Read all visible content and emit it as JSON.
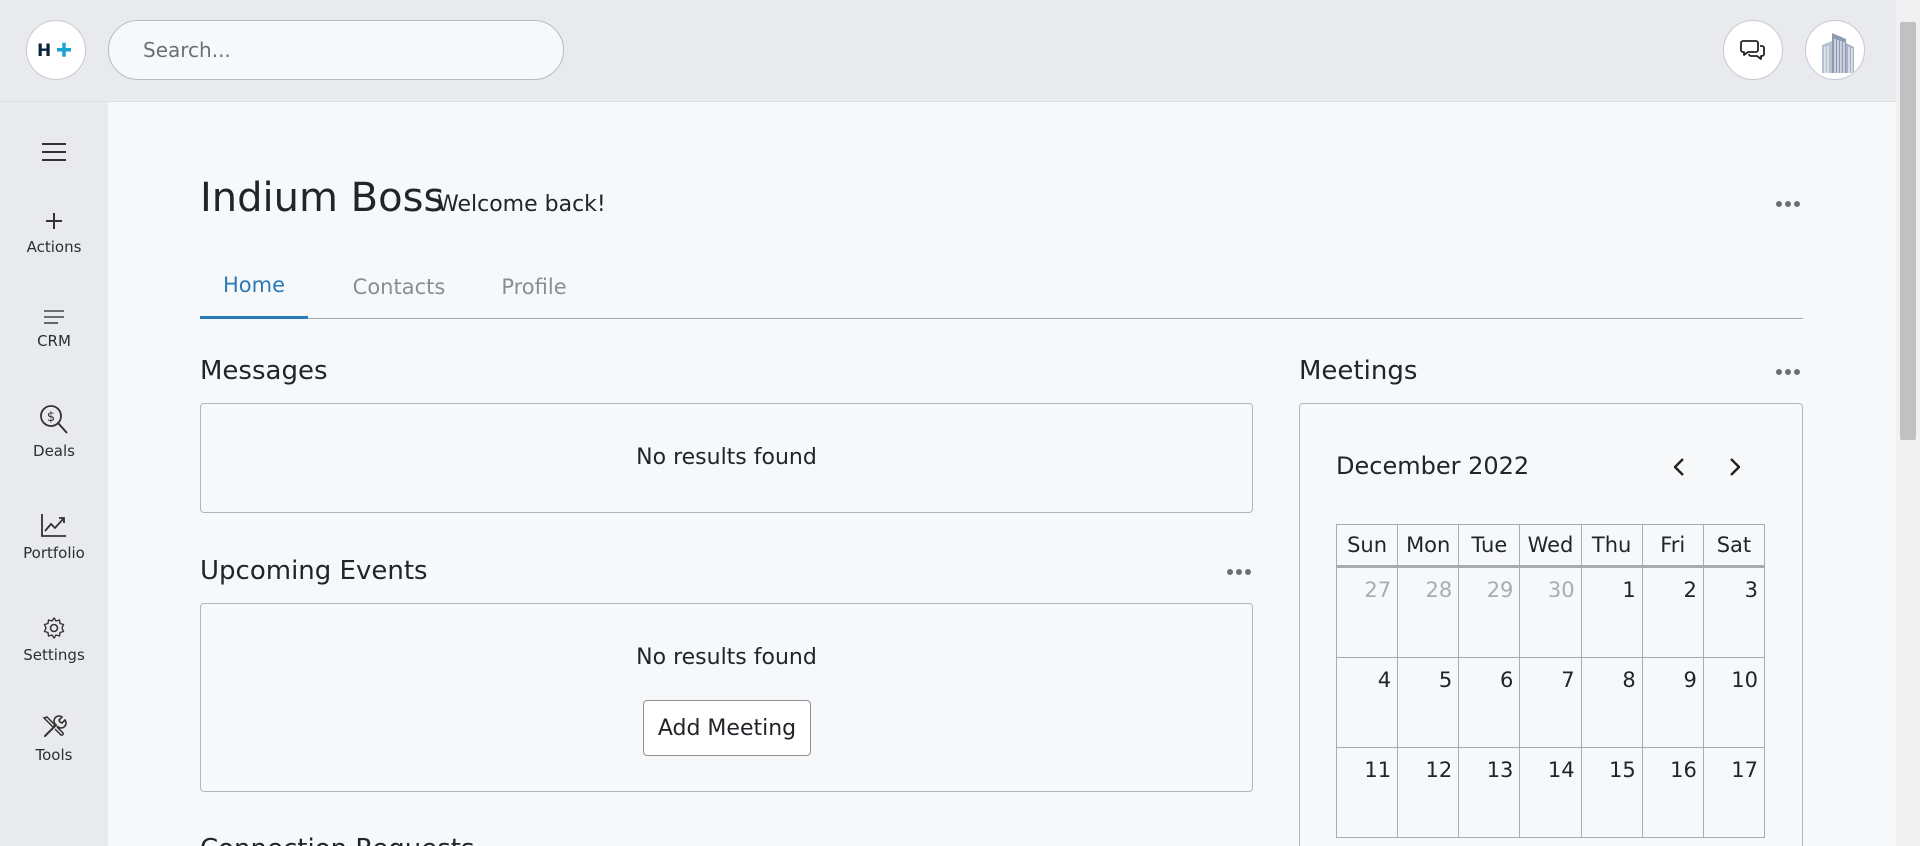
{
  "header": {
    "logo_text": "H+",
    "search_placeholder": "Search..."
  },
  "sidebar": {
    "items": [
      {
        "label": "Actions",
        "icon": "plus-icon"
      },
      {
        "label": "CRM",
        "icon": "list-icon"
      },
      {
        "label": "Deals",
        "icon": "dollar-search-icon"
      },
      {
        "label": "Portfolio",
        "icon": "chart-icon"
      },
      {
        "label": "Settings",
        "icon": "gear-icon"
      },
      {
        "label": "Tools",
        "icon": "tools-icon"
      }
    ]
  },
  "page": {
    "title": "Indium Boss",
    "subtitle": "Welcome back!"
  },
  "tabs": [
    {
      "label": "Home",
      "active": true
    },
    {
      "label": "Contacts",
      "active": false
    },
    {
      "label": "Profile",
      "active": false
    }
  ],
  "messages": {
    "title": "Messages",
    "empty": "No results found"
  },
  "events": {
    "title": "Upcoming Events",
    "empty": "No results found",
    "add_button": "Add Meeting"
  },
  "next_section": {
    "title": "Connection Requests"
  },
  "meetings": {
    "title": "Meetings",
    "month": "December 2022",
    "weekdays": [
      "Sun",
      "Mon",
      "Tue",
      "Wed",
      "Thu",
      "Fri",
      "Sat"
    ],
    "weeks": [
      [
        "27",
        "28",
        "29",
        "30",
        "1",
        "2",
        "3"
      ],
      [
        "4",
        "5",
        "6",
        "7",
        "8",
        "9",
        "10"
      ],
      [
        "11",
        "12",
        "13",
        "14",
        "15",
        "16",
        "17"
      ]
    ],
    "muted_days_in_first_week": 4
  },
  "colors": {
    "accent": "#2a7ab8",
    "logo_plus": "#1aa3d9",
    "logo_h": "#0c2340"
  }
}
